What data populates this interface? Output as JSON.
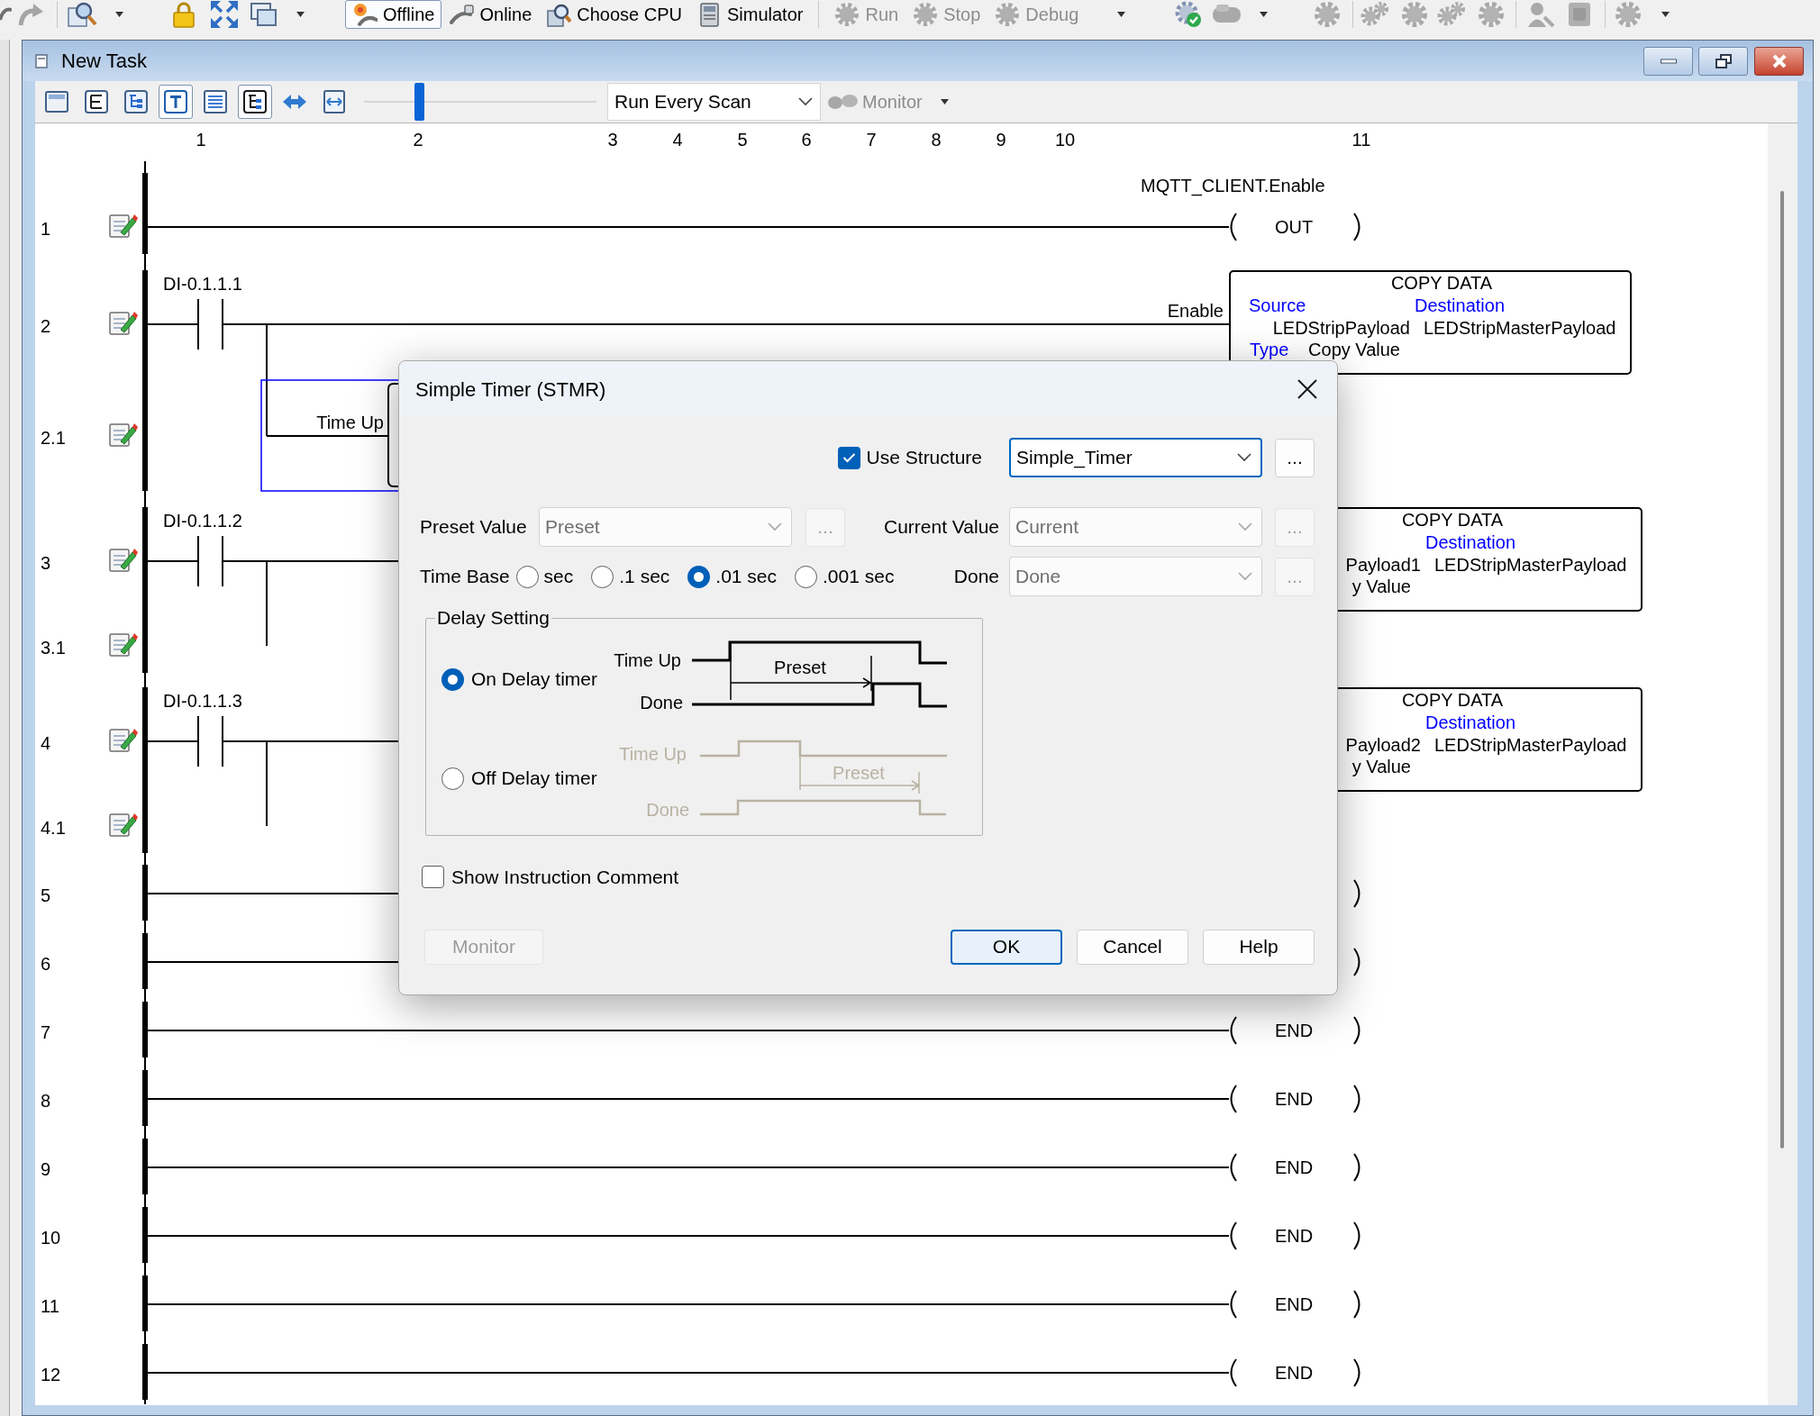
{
  "toolbar": {
    "groups": [
      {
        "buttons": [
          {
            "label": "Offline",
            "selected": true,
            "disabled": false
          },
          {
            "label": "Online",
            "selected": false,
            "disabled": false
          },
          {
            "label": "Choose CPU",
            "selected": false,
            "disabled": false
          },
          {
            "label": "Simulator",
            "selected": false,
            "disabled": false
          }
        ]
      },
      {
        "buttons": [
          {
            "label": "Run",
            "selected": false,
            "disabled": true
          },
          {
            "label": "Stop",
            "selected": false,
            "disabled": true
          },
          {
            "label": "Debug",
            "selected": false,
            "disabled": true
          }
        ]
      }
    ]
  },
  "window": {
    "title": "New Task"
  },
  "editor_toolbar": {
    "tools": [
      {
        "selected": false
      },
      {
        "selected": false
      },
      {
        "selected": false
      },
      {
        "selected": true
      },
      {
        "selected": false
      },
      {
        "selected": true
      },
      {
        "selected": false
      },
      {
        "selected": false
      }
    ],
    "zoom_slider": {
      "level": 0.24
    },
    "scan_mode": {
      "value": "Run Every Scan"
    },
    "monitor": {
      "label": "Monitor",
      "disabled": true
    }
  },
  "ladder": {
    "columns": [
      "1",
      "2",
      "3",
      "4",
      "5",
      "6",
      "7",
      "8",
      "9",
      "10",
      "11"
    ],
    "rows": [
      {
        "number": "1",
        "kind": "rung",
        "edit_mark": true,
        "output": {
          "kind": "coil",
          "tag": "MQTT_CLIENT.Enable",
          "instruction": "OUT"
        }
      },
      {
        "number": "2",
        "kind": "rung",
        "edit_mark": true,
        "contact": {
          "tag": "DI-0.1.1.1"
        },
        "output": {
          "kind": "block",
          "input": "Enable",
          "title": "COPY DATA",
          "source_label": "Source",
          "destination_label": "Destination",
          "source_value": "LEDStripPayload",
          "destination_value": "LEDStripMasterPayload",
          "type_label": "Type",
          "type_value": "Copy Value"
        }
      },
      {
        "number": "2.1",
        "kind": "branch",
        "edit_mark": true,
        "output": {
          "kind": "timer",
          "input": "Time Up",
          "selected": true
        }
      },
      {
        "number": "3",
        "kind": "rung",
        "edit_mark": true,
        "contact": {
          "tag": "DI-0.1.1.2"
        },
        "output": {
          "kind": "block",
          "title": "COPY DATA",
          "destination_label": "Destination",
          "source_value": "Payload1",
          "destination_value": "LEDStripMasterPayload",
          "type_value": "y Value"
        }
      },
      {
        "number": "3.1",
        "kind": "branch",
        "edit_mark": true
      },
      {
        "number": "4",
        "kind": "rung",
        "edit_mark": true,
        "contact": {
          "tag": "DI-0.1.1.3"
        },
        "output": {
          "kind": "block",
          "title": "COPY DATA",
          "destination_label": "Destination",
          "source_value": "Payload2",
          "destination_value": "LEDStripMasterPayload",
          "type_value": "y Value"
        }
      },
      {
        "number": "4.1",
        "kind": "branch",
        "edit_mark": true
      },
      {
        "number": "5",
        "kind": "rung",
        "edit_mark": false,
        "output": {
          "kind": "coil"
        }
      },
      {
        "number": "6",
        "kind": "rung",
        "edit_mark": false,
        "output": {
          "kind": "coil"
        }
      },
      {
        "number": "7",
        "kind": "rung",
        "edit_mark": false,
        "output": {
          "kind": "coil",
          "instruction": "END"
        }
      },
      {
        "number": "8",
        "kind": "rung",
        "edit_mark": false,
        "output": {
          "kind": "coil",
          "instruction": "END"
        }
      },
      {
        "number": "9",
        "kind": "rung",
        "edit_mark": false,
        "output": {
          "kind": "coil",
          "instruction": "END"
        }
      },
      {
        "number": "10",
        "kind": "rung",
        "edit_mark": false,
        "output": {
          "kind": "coil",
          "instruction": "END"
        }
      },
      {
        "number": "11",
        "kind": "rung",
        "edit_mark": false,
        "output": {
          "kind": "coil",
          "instruction": "END"
        }
      },
      {
        "number": "12",
        "kind": "rung",
        "edit_mark": false,
        "output": {
          "kind": "coil",
          "instruction": "END"
        }
      }
    ]
  },
  "dialog": {
    "title": "Simple Timer (STMR)",
    "use_structure": {
      "label": "Use Structure",
      "checked": true
    },
    "structure": {
      "value": "Simple_Timer",
      "disabled": false,
      "focused": true,
      "browse": {
        "label": "...",
        "disabled": false
      }
    },
    "preset_value": {
      "label": "Preset Value",
      "value": "Preset",
      "disabled": true,
      "focused": false,
      "browse": {
        "label": "...",
        "disabled": true
      }
    },
    "current_value": {
      "label": "Current Value",
      "value": "Current",
      "disabled": true,
      "focused": false,
      "browse": {
        "label": "...",
        "disabled": true
      }
    },
    "time_base": {
      "label": "Time Base",
      "options": [
        {
          "label": "sec",
          "selected": false
        },
        {
          "label": ".1 sec",
          "selected": false
        },
        {
          "label": ".01 sec",
          "selected": true
        },
        {
          "label": ".001 sec",
          "selected": false
        }
      ]
    },
    "done": {
      "label": "Done",
      "value": "Done",
      "disabled": true,
      "focused": false,
      "browse": {
        "label": "...",
        "disabled": true
      }
    },
    "delay_setting": {
      "title": "Delay Setting",
      "options": [
        {
          "kind": "on_delay",
          "label": "On Delay timer",
          "selected": true,
          "signals": [
            "Time Up",
            "Done"
          ],
          "interval": "Preset"
        },
        {
          "kind": "off_delay",
          "label": "Off Delay timer",
          "selected": false,
          "signals": [
            "Time Up",
            "Done"
          ],
          "interval": "Preset"
        }
      ]
    },
    "show_comment": {
      "label": "Show Instruction Comment",
      "checked": false
    },
    "buttons": [
      {
        "label": "Monitor",
        "disabled": true,
        "default": false
      },
      {
        "label": "OK",
        "disabled": false,
        "default": true
      },
      {
        "label": "Cancel",
        "disabled": false,
        "default": false
      },
      {
        "label": "Help",
        "disabled": false,
        "default": false
      }
    ]
  }
}
